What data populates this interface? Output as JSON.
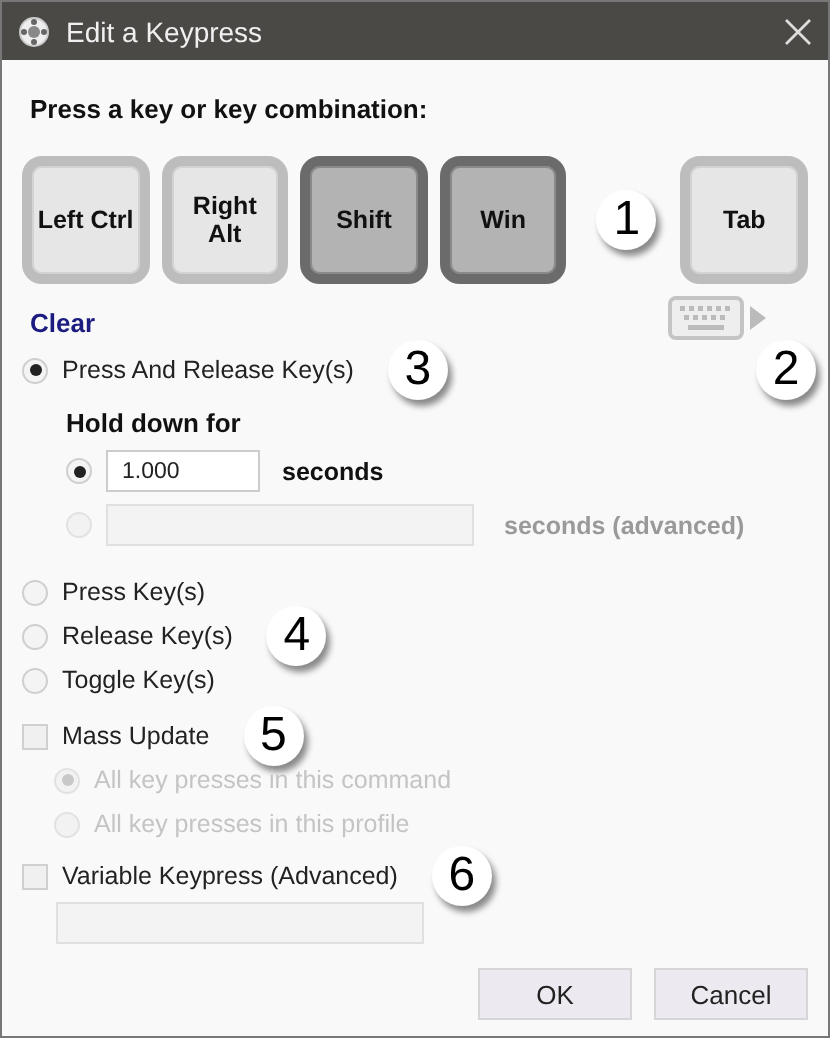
{
  "window": {
    "title": "Edit a Keypress"
  },
  "prompt": "Press a key or key combination:",
  "keys": [
    {
      "label": "Left Ctrl",
      "pressed": false
    },
    {
      "label": "Right Alt",
      "pressed": false
    },
    {
      "label": "Shift",
      "pressed": true
    },
    {
      "label": "Win",
      "pressed": true,
      "callout": "1"
    },
    {
      "label": "Tab",
      "pressed": false
    }
  ],
  "clear_link": "Clear",
  "keyboard_callout": "2",
  "actions": [
    {
      "kind": "hold",
      "label": "Press And Release Key(s)",
      "selected": true,
      "callout": "3"
    },
    {
      "kind": "plain",
      "label": "Press Key(s)",
      "selected": false
    },
    {
      "kind": "plain",
      "label": "Release Key(s)",
      "selected": false,
      "callout": "4"
    },
    {
      "kind": "plain",
      "label": "Toggle Key(s)",
      "selected": false
    }
  ],
  "hold": {
    "label": "Hold down for",
    "options": [
      {
        "kind": "short",
        "value": "1.000",
        "unit": "seconds",
        "selected": true,
        "disabled": false
      },
      {
        "kind": "long",
        "unit": "seconds (advanced)",
        "selected": false,
        "disabled": true
      }
    ]
  },
  "mass_update": {
    "label": "Mass Update",
    "checked": false,
    "callout": "5",
    "scope": [
      {
        "label": "All key presses in this command",
        "selected": true,
        "disabled": true
      },
      {
        "label": "All key presses in this profile",
        "selected": false,
        "disabled": true
      }
    ]
  },
  "variable_keypress": {
    "label": "Variable Keypress (Advanced)",
    "checked": false,
    "callout": "6"
  },
  "buttons": [
    "OK",
    "Cancel"
  ]
}
